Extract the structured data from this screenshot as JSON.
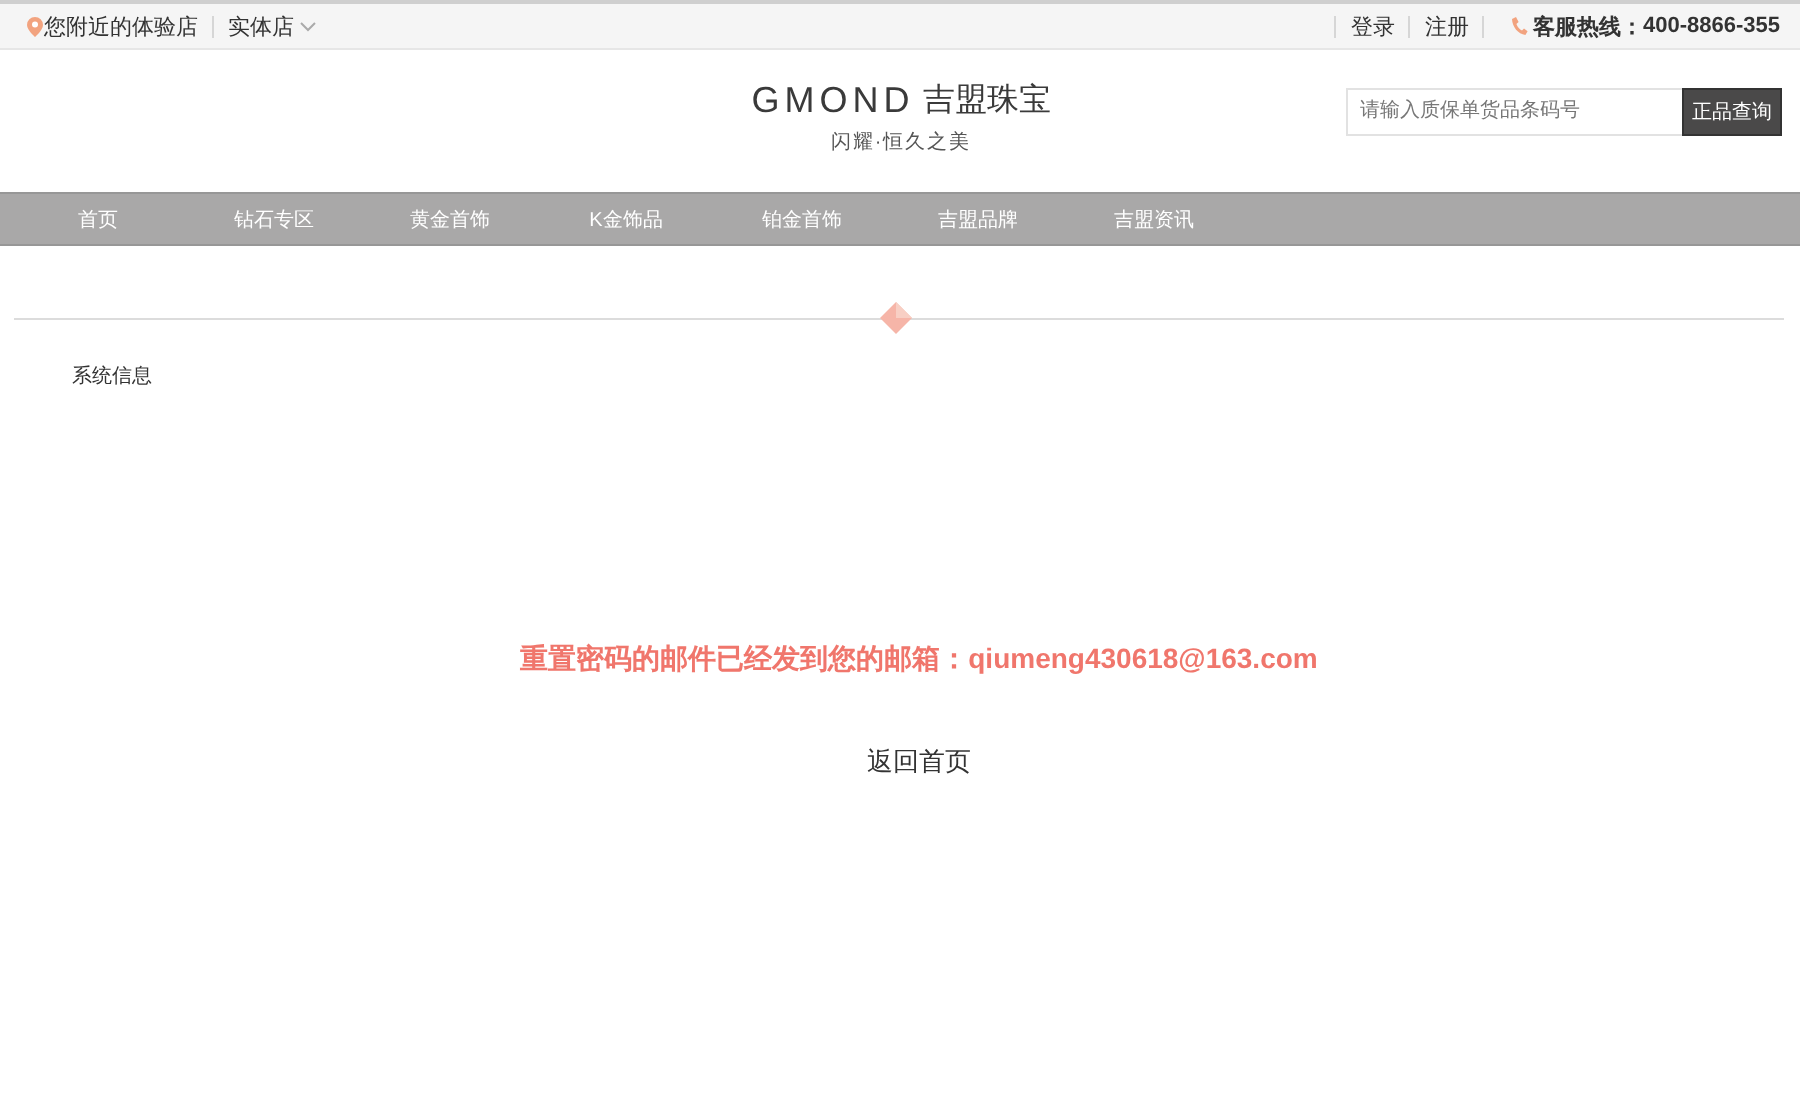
{
  "top_bar": {
    "store_locator": "您附近的体验店",
    "store_dropdown": "实体店",
    "links": [
      "登录",
      "注册"
    ],
    "hotline_label": "客服热线：",
    "hotline_number": "400-8866-355"
  },
  "header": {
    "logo_text": "GMOND",
    "logo_chinese": "吉盟珠宝",
    "slogan": "闪耀·恒久之美",
    "search": {
      "placeholder": "请输入质保单货品条码号",
      "button": "正品查询"
    }
  },
  "nav": [
    {
      "label": "首页"
    },
    {
      "label": "钻石专区"
    },
    {
      "label": "黄金首饰"
    },
    {
      "label": "K金饰品"
    },
    {
      "label": "铂金首饰"
    },
    {
      "label": "吉盟品牌"
    },
    {
      "label": "吉盟资讯"
    }
  ],
  "section_title": "系统信息",
  "message": "重置密码的邮件已经发到您的邮箱：qiumeng430618@163.com",
  "back_link": "返回首页"
}
